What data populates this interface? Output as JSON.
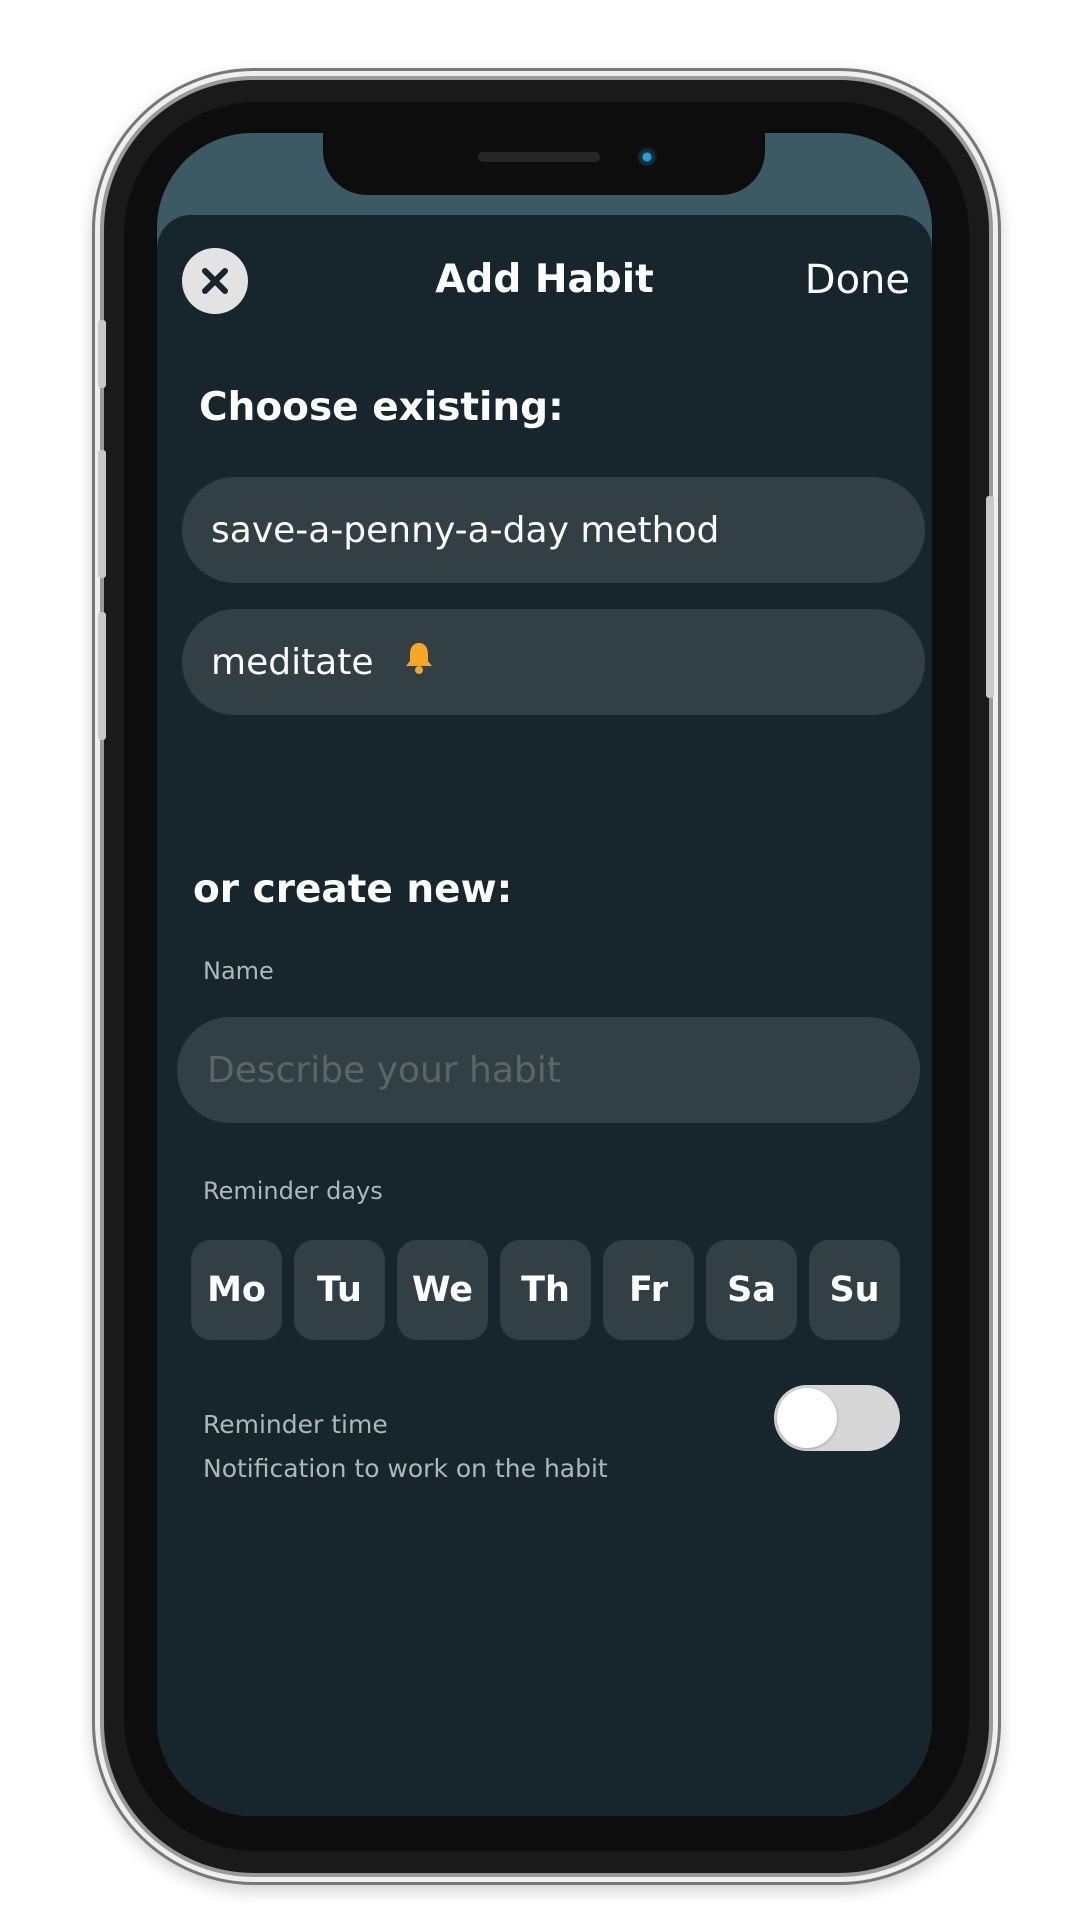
{
  "header": {
    "title": "Add Habit",
    "done_label": "Done",
    "close_icon": "close-icon"
  },
  "existing": {
    "heading": "Choose existing:",
    "habits": [
      {
        "label": "save-a-penny-a-day method",
        "has_reminder": false
      },
      {
        "label": "meditate",
        "has_reminder": true,
        "reminder_icon": "bell-icon"
      }
    ]
  },
  "create": {
    "heading": "or create new:",
    "name_label": "Name",
    "name_placeholder": "Describe your habit",
    "name_value": "",
    "reminder_days_label": "Reminder days",
    "days": [
      "Mo",
      "Tu",
      "We",
      "Th",
      "Fr",
      "Sa",
      "Su"
    ],
    "reminder_time_label": "Reminder time",
    "reminder_time_hint": "Notification to work on the habit",
    "reminder_time_enabled": false
  },
  "colors": {
    "sheet_bg": "#17262d",
    "pill_bg": "#323f45",
    "accent_bell": "#f5a623",
    "status_bar_bg": "#3b5a63"
  }
}
